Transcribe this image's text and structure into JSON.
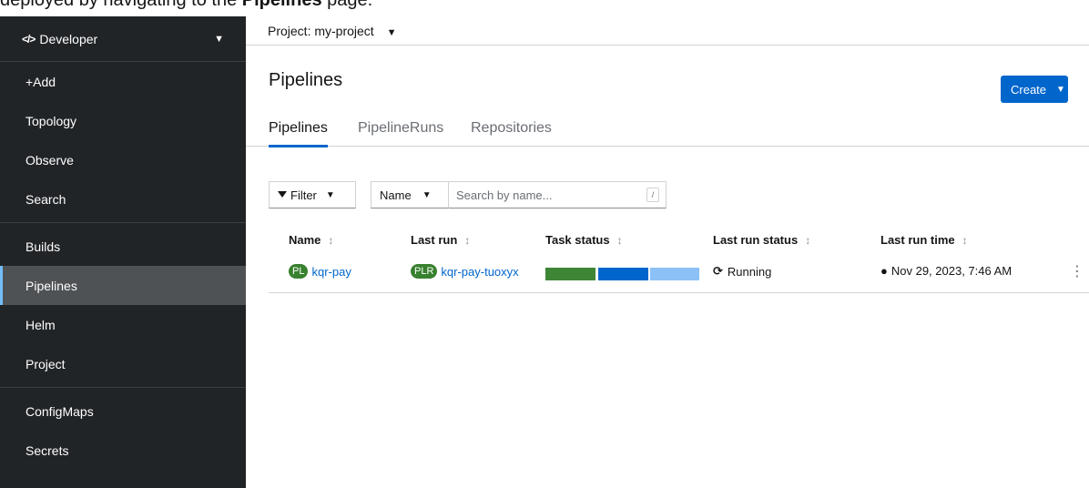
{
  "caption": {
    "text_before": "deployed by navigating to the ",
    "text_bold": "Pipelines",
    "text_after": " page."
  },
  "sidebar": {
    "perspective": {
      "icon": "code-icon",
      "label": "Developer"
    },
    "items": [
      {
        "label": "+Add"
      },
      {
        "label": "Topology"
      },
      {
        "label": "Observe"
      },
      {
        "label": "Search"
      },
      {
        "label": "Builds"
      },
      {
        "label": "Pipelines",
        "active": true
      },
      {
        "label": "Helm"
      },
      {
        "label": "Project"
      },
      {
        "label": "ConfigMaps"
      },
      {
        "label": "Secrets"
      }
    ]
  },
  "topbar": {
    "project_label": "Project: my-project"
  },
  "page": {
    "title": "Pipelines",
    "create_label": "Create",
    "tabs": [
      {
        "label": "Pipelines",
        "active": true
      },
      {
        "label": "PipelineRuns"
      },
      {
        "label": "Repositories"
      }
    ]
  },
  "filters": {
    "filter_label": "Filter",
    "name_label": "Name",
    "search_placeholder": "Search by name...",
    "shortcut": "/"
  },
  "table": {
    "columns": [
      "Name",
      "Last run",
      "Task status",
      "Last run status",
      "Last run time"
    ],
    "rows": [
      {
        "name_badge": "PL",
        "name": "kqr-pay",
        "run_badge": "PLR",
        "last_run": "kqr-pay-tuoxyx",
        "task_status_colors": [
          "#3e8635",
          "#0066cc",
          "#8bc1f7"
        ],
        "last_run_status": "Running",
        "last_run_time": "Nov 29, 2023, 7:46 AM"
      }
    ]
  },
  "colors": {
    "accent": "#0066cc",
    "sidebar_bg": "#212427",
    "badge_green": "#38812f"
  },
  "icons": {
    "sort": "sort-icon",
    "running": "sync-icon",
    "time": "globe-icon",
    "row_menu": "kebab-icon"
  }
}
